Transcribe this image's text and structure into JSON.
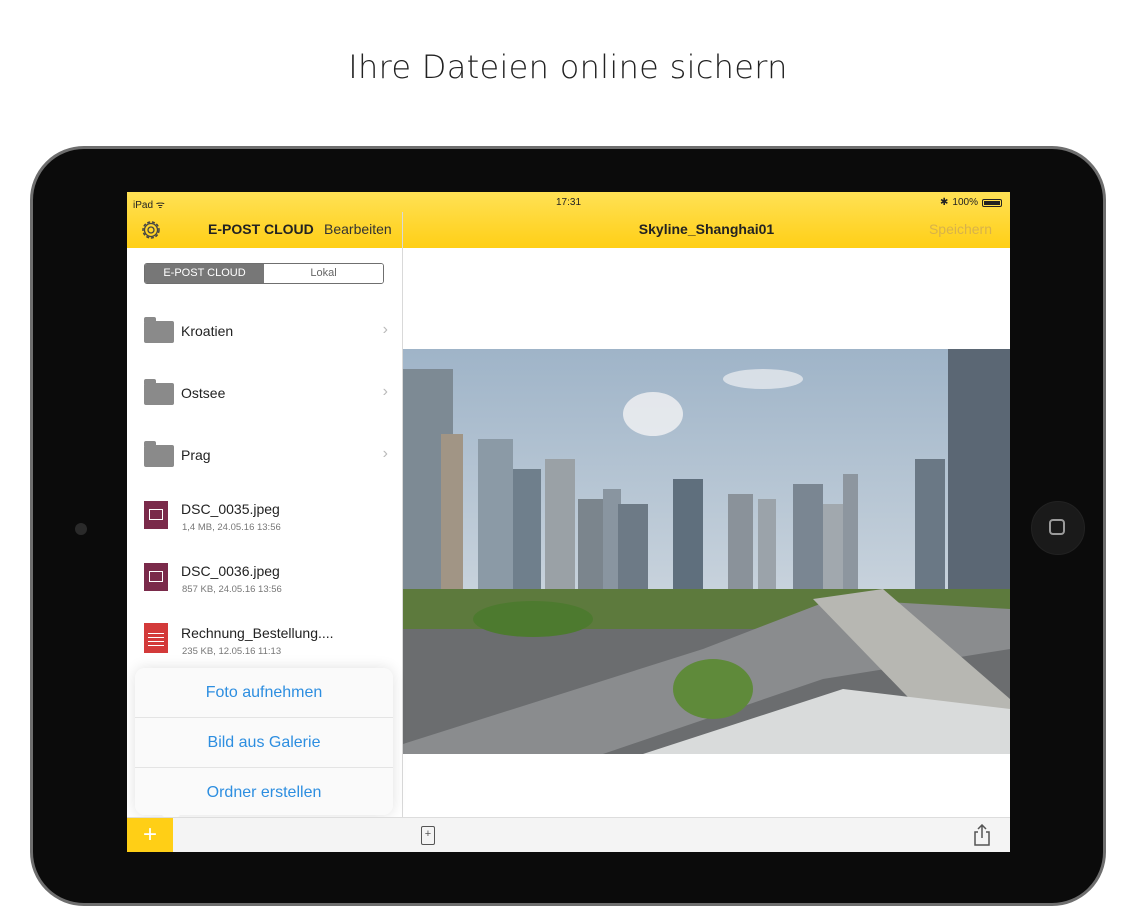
{
  "headline": "Ihre Dateien online sichern",
  "status": {
    "carrier": "iPad",
    "time": "17:31",
    "battery": "100%"
  },
  "header": {
    "app_title": "E-POST CLOUD",
    "edit_label": "Bearbeiten",
    "file_title": "Skyline_Shanghai01",
    "save_label": "Speichern"
  },
  "segment": {
    "cloud": "E-POST CLOUD",
    "local": "Lokal"
  },
  "folders": [
    {
      "label": "Kroatien"
    },
    {
      "label": "Ostsee"
    },
    {
      "label": "Prag"
    }
  ],
  "files": [
    {
      "name": "DSC_0035.jpeg",
      "meta": "1,4 MB, 24.05.16 13:56",
      "icon": "image-file-icon"
    },
    {
      "name": "DSC_0036.jpeg",
      "meta": "857 KB, 24.05.16 13:56",
      "icon": "image-file-icon"
    },
    {
      "name": "Rechnung_Bestellung....",
      "meta": "235 KB, 12.05.16 11:13",
      "icon": "pdf-file-icon"
    }
  ],
  "popup": {
    "take_photo": "Foto aufnehmen",
    "from_gallery": "Bild aus Galerie",
    "create_folder": "Ordner erstellen"
  },
  "toolbar": {
    "add": "+"
  },
  "colors": {
    "brand_yellow": "#ffcf16",
    "link_blue": "#2d8ee0",
    "save_disabled": "#d8b24a"
  }
}
